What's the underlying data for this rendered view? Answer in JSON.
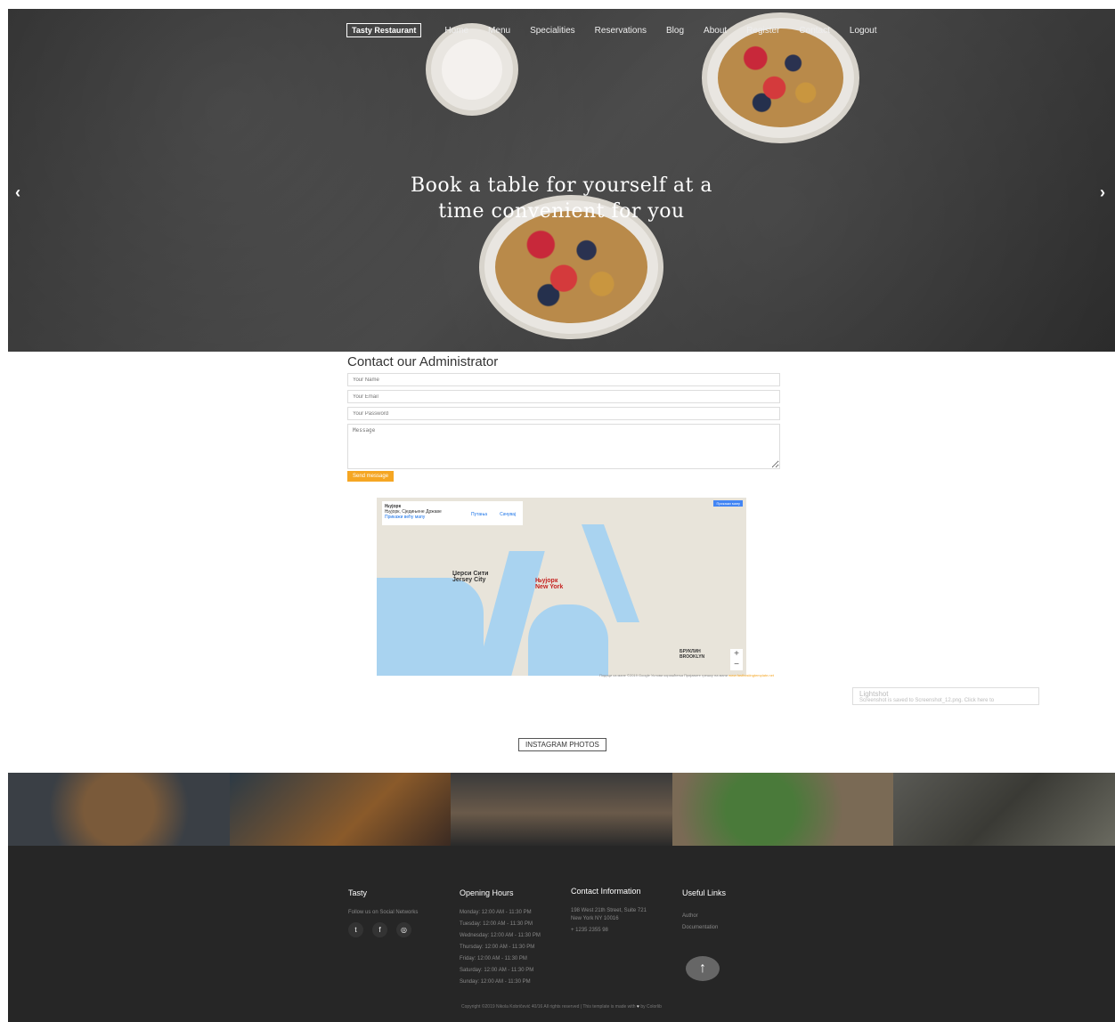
{
  "nav": {
    "brand": "Tasty Restaurant",
    "items": [
      "Home",
      "Menu",
      "Specialities",
      "Reservations",
      "Blog",
      "About",
      "Register",
      "Contact",
      "Logout"
    ]
  },
  "hero": {
    "title_line1": "Book a table for yourself at a",
    "title_line2": "time convenient for you",
    "prev_icon": "‹",
    "next_icon": "›"
  },
  "contact": {
    "heading": "Contact our Administrator",
    "name_placeholder": "Your Name",
    "email_placeholder": "Your Email",
    "password_placeholder": "Your Password",
    "message_placeholder": "Message",
    "send_label": "Send message"
  },
  "map": {
    "card_title": "Њујорк",
    "card_sub": "Њујорк, Сједињене Државе",
    "card_link": "Прикажи већу мапу",
    "directions": "Путања",
    "save": "Сачувај",
    "label_ny": "Њујорк",
    "label_ny_en": "New York",
    "label_jc": "Џерси Сити",
    "label_jc_en": "Jersey City",
    "label_bk": "БРУКЛИН",
    "label_bk_en": "BROOKLYN",
    "zoom_in": "+",
    "zoom_out": "−",
    "badge": "Прикажи мапу",
    "credit": "Подаци са мапе ©2019 Google  Услови коришћења  Пријавите грешку на мапи",
    "credit_link": "www.fasthostingtemplate.net"
  },
  "lightshot": {
    "title": "Lightshot",
    "text": "Screenshot is saved to Screenshot_12.png. Click here to"
  },
  "instagram": {
    "label": "INSTAGRAM PHOTOS"
  },
  "footer": {
    "tasty": {
      "title": "Tasty",
      "follow": "Follow us on Social Networks",
      "icons": [
        "twitter-icon",
        "facebook-icon",
        "instagram-icon"
      ]
    },
    "hours": {
      "title": "Opening Hours",
      "rows": [
        "Monday: 12:00 AM - 11:30 PM",
        "Tuesday: 12:00 AM - 11:30 PM",
        "Wednesday: 12:00 AM - 11:30 PM",
        "Thursday: 12:00 AM - 11:30 PM",
        "Friday: 12:00 AM - 11:30 PM",
        "Saturday: 12:00 AM - 11:30 PM",
        "Sunday: 12:00 AM - 11:30 PM"
      ]
    },
    "contact": {
      "title": "Contact Information",
      "address1": "198 West 21th Street, Suite 721",
      "address2": "New York NY 10016",
      "phone": "+ 1235 2355 98"
    },
    "links": {
      "title": "Useful Links",
      "items": [
        "Author",
        "Documentation"
      ]
    },
    "copyright_pre": "Copyright ©2019 Nikola Kobričević 40/16 All rights reserved | This template is made with",
    "copyright_post": "by Colorlib",
    "to_top_icon": "↑"
  },
  "colors": {
    "accent": "#f5a623",
    "footer_bg": "#262626"
  }
}
